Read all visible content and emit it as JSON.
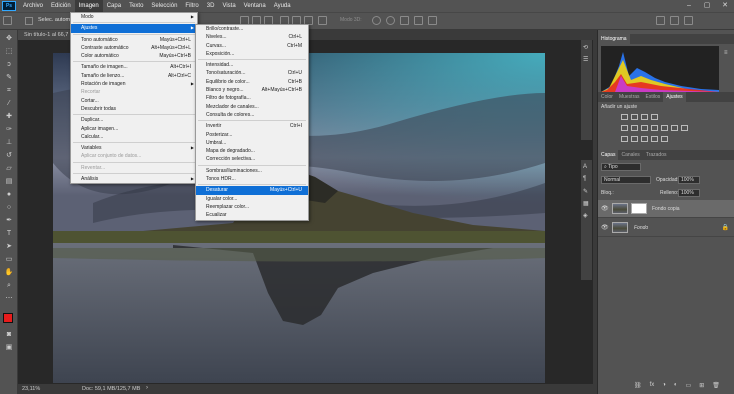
{
  "menubar": {
    "logo": "Ps",
    "items": [
      "Archivo",
      "Edición",
      "Imagen",
      "Capa",
      "Texto",
      "Selección",
      "Filtro",
      "3D",
      "Vista",
      "Ventana",
      "Ayuda"
    ],
    "active_index": 2
  },
  "optionsbar": {
    "tool_label": "Selec. autom",
    "mode3d": "Modo 3D:"
  },
  "document": {
    "tab_title": "Sin título-1 al 66,7"
  },
  "statusbar": {
    "zoom": "23,11%",
    "doc_info": "Doc: 59,1 MB/125,7 MB"
  },
  "imagen_menu": [
    {
      "label": "Modo",
      "submenu": true
    },
    {
      "sep": true
    },
    {
      "label": "Ajustes",
      "submenu": true,
      "highlight": true
    },
    {
      "sep": true
    },
    {
      "label": "Tono automático",
      "shortcut": "Mayús+Ctrl+L"
    },
    {
      "label": "Contraste automático",
      "shortcut": "Alt+Mayús+Ctrl+L"
    },
    {
      "label": "Color automático",
      "shortcut": "Mayús+Ctrl+B"
    },
    {
      "sep": true
    },
    {
      "label": "Tamaño de imagen...",
      "shortcut": "Alt+Ctrl+I"
    },
    {
      "label": "Tamaño de lienzo...",
      "shortcut": "Alt+Ctrl+C"
    },
    {
      "label": "Rotación de imagen",
      "submenu": true
    },
    {
      "label": "Recortar",
      "disabled": true
    },
    {
      "label": "Cortar..."
    },
    {
      "label": "Descubrir todas"
    },
    {
      "sep": true
    },
    {
      "label": "Duplicar..."
    },
    {
      "label": "Aplicar imagen..."
    },
    {
      "label": "Calcular..."
    },
    {
      "sep": true
    },
    {
      "label": "Variables",
      "submenu": true
    },
    {
      "label": "Aplicar conjunto de datos...",
      "disabled": true
    },
    {
      "sep": true
    },
    {
      "label": "Reventar...",
      "disabled": true
    },
    {
      "sep": true
    },
    {
      "label": "Análisis",
      "submenu": true
    }
  ],
  "ajustes_menu": [
    {
      "label": "Brillo/contraste..."
    },
    {
      "label": "Niveles...",
      "shortcut": "Ctrl+L"
    },
    {
      "label": "Curvas...",
      "shortcut": "Ctrl+M"
    },
    {
      "label": "Exposición..."
    },
    {
      "sep": true
    },
    {
      "label": "Intensidad..."
    },
    {
      "label": "Tono/saturación...",
      "shortcut": "Ctrl+U"
    },
    {
      "label": "Equilibrio de color...",
      "shortcut": "Ctrl+B"
    },
    {
      "label": "Blanco y negro...",
      "shortcut": "Alt+Mayús+Ctrl+B"
    },
    {
      "label": "Filtro de fotografía..."
    },
    {
      "label": "Mezclador de canales..."
    },
    {
      "label": "Consulta de colores..."
    },
    {
      "sep": true
    },
    {
      "label": "Invertir",
      "shortcut": "Ctrl+I"
    },
    {
      "label": "Posterizar..."
    },
    {
      "label": "Umbral..."
    },
    {
      "label": "Mapa de degradado..."
    },
    {
      "label": "Corrección selectiva..."
    },
    {
      "sep": true
    },
    {
      "label": "Sombras/iluminaciones..."
    },
    {
      "label": "Tonos HDR..."
    },
    {
      "sep": true
    },
    {
      "label": "Desaturar",
      "shortcut": "Mayús+Ctrl+U",
      "highlight": true
    },
    {
      "label": "Igualar color..."
    },
    {
      "label": "Reemplazar color..."
    },
    {
      "label": "Ecualizar"
    }
  ],
  "histogram_panel": {
    "tab": "Histograma"
  },
  "adjust_panel": {
    "tabs": [
      "Color",
      "Muestras",
      "Estilos",
      "Ajustes"
    ],
    "active_tab": 3,
    "heading": "Añadir un ajuste"
  },
  "layers_panel": {
    "tabs": [
      "Capas",
      "Canales",
      "Trazados"
    ],
    "active_tab": 0,
    "filter": "Tipo",
    "blend_mode": "Normal",
    "opacity_label": "Opacidad:",
    "opacity_value": "100%",
    "lock_label": "Bloq.:",
    "fill_label": "Relleno:",
    "fill_value": "100%",
    "layers": [
      {
        "name": "Fondo copia",
        "selected": true
      },
      {
        "name": "Fondo",
        "selected": false
      }
    ]
  },
  "colors": {
    "menu_highlight": "#0f6fd6",
    "foreground": "#e81c1c",
    "background": "#ffffff",
    "ps_blue": "#31a8ff"
  }
}
